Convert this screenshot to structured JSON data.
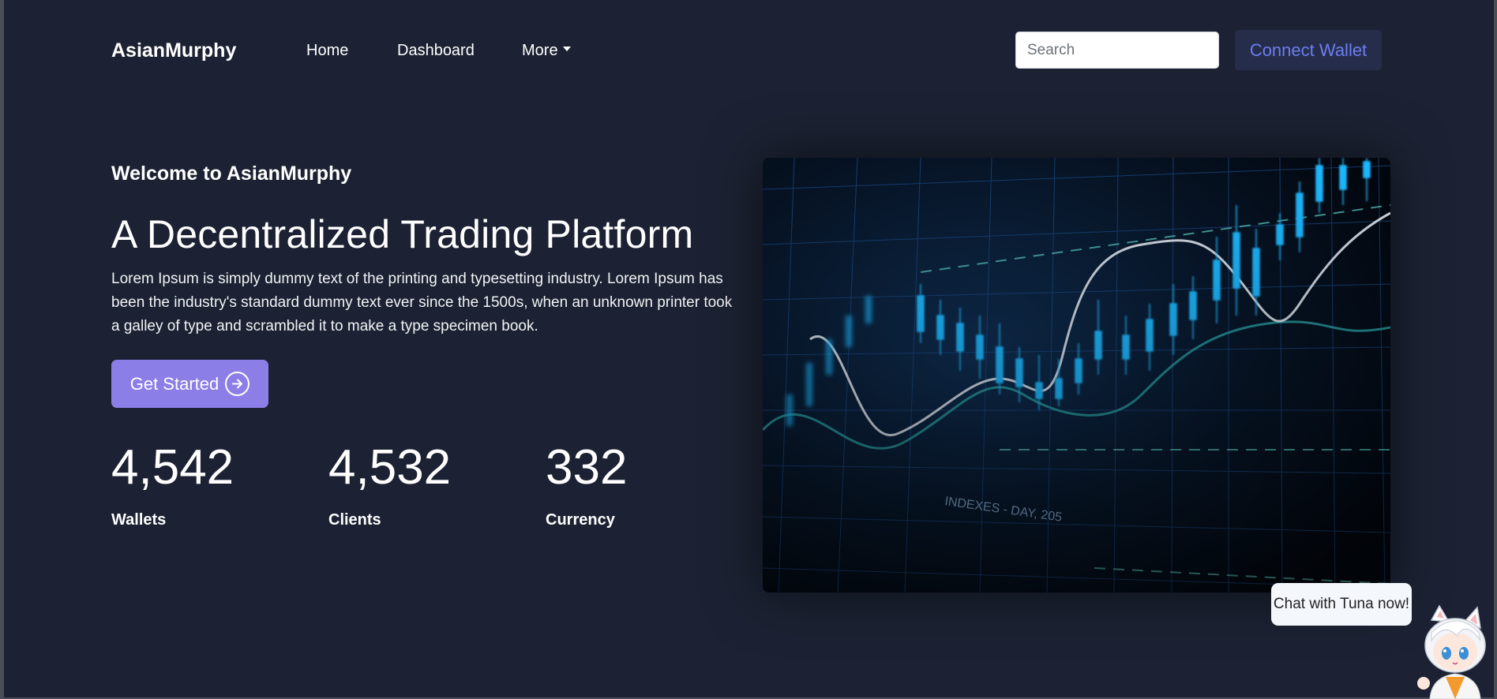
{
  "nav": {
    "brand": "AsianMurphy",
    "links": [
      "Home",
      "Dashboard",
      "More"
    ],
    "search_placeholder": "Search",
    "connect_label": "Connect Wallet"
  },
  "hero": {
    "welcome": "Welcome to AsianMurphy",
    "title": "A Decentralized Trading Platform",
    "description": "Lorem Ipsum is simply dummy text of the printing and typesetting industry. Lorem Ipsum has been the industry's standard dummy text ever since the 1500s, when an unknown printer took a galley of type and scrambled it to make a type specimen book.",
    "cta_label": "Get Started",
    "image_caption": "INDEXES - DAY, 205"
  },
  "stats": [
    {
      "value": "4,542",
      "label": "Wallets"
    },
    {
      "value": "4,532",
      "label": "Clients"
    },
    {
      "value": "332",
      "label": "Currency"
    }
  ],
  "chat": {
    "label": "Chat with Tuna now!"
  },
  "colors": {
    "page_bg": "#1c2233",
    "cta": "#8b7ee6",
    "connect_text": "#6b7ef0",
    "connect_bg": "#252d4a",
    "candle": "#1fb8ff"
  },
  "icons": {
    "cta_icon": "arrow-right-circle-icon",
    "more_caret": "caret-down-icon"
  }
}
